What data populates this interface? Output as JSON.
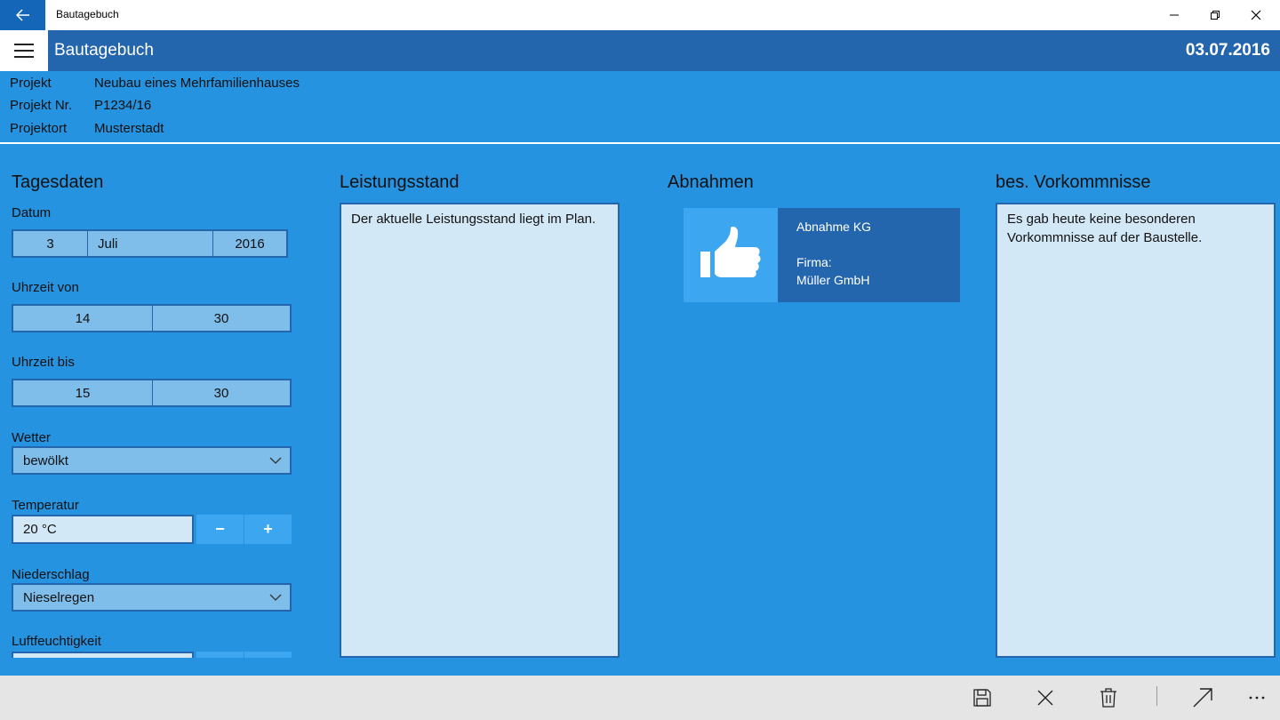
{
  "window": {
    "title": "Bautagebuch"
  },
  "header": {
    "title": "Bautagebuch",
    "date": "03.07.2016"
  },
  "project": {
    "rows": [
      {
        "label": "Projekt",
        "value": "Neubau eines Mehrfamilienhauses"
      },
      {
        "label": "Projekt Nr.",
        "value": "P1234/16"
      },
      {
        "label": "Projektort",
        "value": "Musterstadt"
      }
    ]
  },
  "tagesdaten": {
    "title": "Tagesdaten",
    "datum": {
      "label": "Datum",
      "day": "3",
      "month": "Juli",
      "year": "2016"
    },
    "uhrzeit_von": {
      "label": "Uhrzeit von",
      "hour": "14",
      "minute": "30"
    },
    "uhrzeit_bis": {
      "label": "Uhrzeit bis",
      "hour": "15",
      "minute": "30"
    },
    "wetter": {
      "label": "Wetter",
      "value": "bewölkt"
    },
    "temperatur": {
      "label": "Temperatur",
      "value": "20 °C",
      "minus": "−",
      "plus": "+"
    },
    "niederschlag": {
      "label": "Niederschlag",
      "value": "Nieselregen"
    },
    "luftfeuchtigkeit": {
      "label": "Luftfeuchtigkeit"
    }
  },
  "leistungsstand": {
    "title": "Leistungsstand",
    "text": "Der aktuelle Leistungsstand liegt im Plan."
  },
  "abnahmen": {
    "title": "Abnahmen",
    "items": [
      {
        "name": "Abnahme KG",
        "firma_label": "Firma:",
        "firma": "Müller GmbH",
        "icon": "thumbs-up-icon"
      }
    ]
  },
  "vorkommnisse": {
    "title": "bes. Vorkommnisse",
    "text": "Es gab heute keine besonderen Vorkommnisse auf der Baustelle."
  },
  "commandbar": {
    "icons": [
      "save-icon",
      "close-icon",
      "delete-icon",
      "share-icon",
      "more-icon"
    ]
  },
  "colors": {
    "accent": "#2466AD",
    "background": "#2593E0",
    "tile": "#3CA6F1",
    "input": "#7FBDEB",
    "textarea": "#D3E8F6"
  }
}
